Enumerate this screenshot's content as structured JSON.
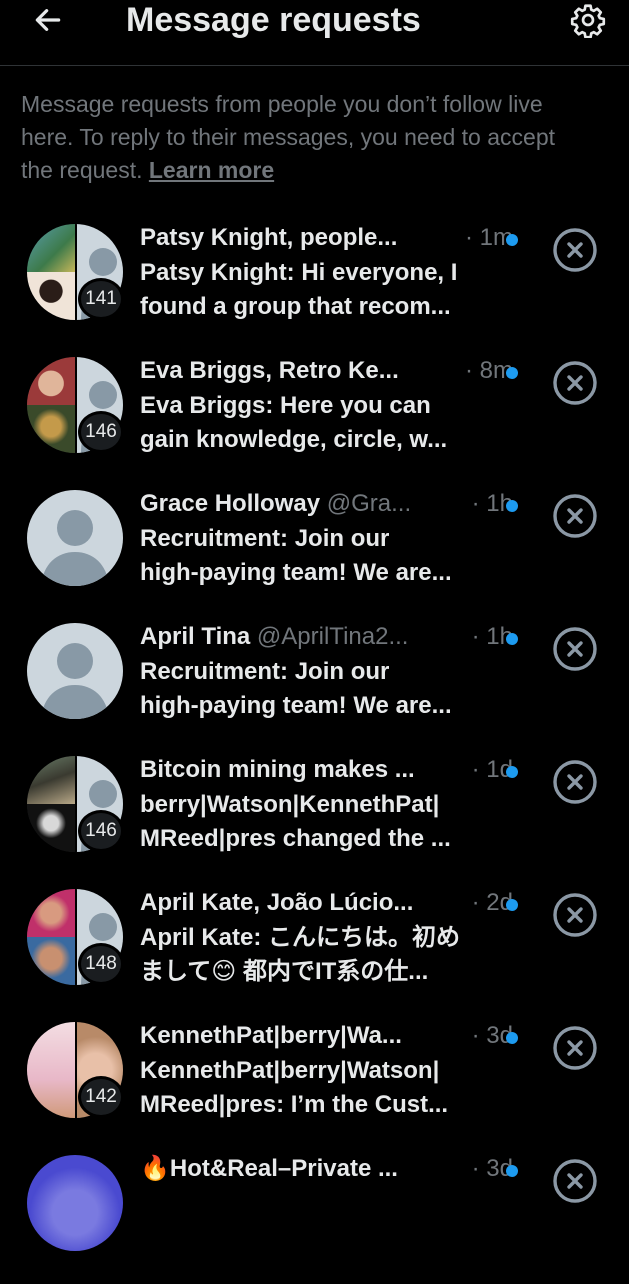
{
  "header": {
    "title": "Message requests"
  },
  "info": {
    "lines": [
      "Message requests from people you don’t follow live",
      "here. To reply to their messages, you need to accept",
      "the request."
    ],
    "learn_more": "Learn more"
  },
  "requests": [
    {
      "name": "Patsy Knight, people...",
      "handle": "",
      "time": "· 1m",
      "count": "141",
      "msg1": "Patsy Knight: Hi everyone, I",
      "msg2": "found a group that recom..."
    },
    {
      "name": "Eva Briggs, Retro Ke...",
      "handle": "",
      "time": "· 8m",
      "count": "146",
      "msg1": "Eva Briggs: Here you can",
      "msg2": "gain knowledge, circle, w..."
    },
    {
      "name": "Grace Holloway",
      "handle": "@Gra...",
      "time": "· 1h",
      "count": "",
      "msg1": "Recruitment: Join our",
      "msg2": "high-paying team! We are..."
    },
    {
      "name": "April Tina",
      "handle": "@AprilTina2...",
      "time": "· 1h",
      "count": "",
      "msg1": "Recruitment: Join our",
      "msg2": "high-paying team! We are..."
    },
    {
      "name": "Bitcoin mining makes ...",
      "handle": "",
      "time": "· 1d",
      "count": "146",
      "msg1": "berry|Watson|KennethPat|",
      "msg2": "MReed|pres changed the ..."
    },
    {
      "name": "April Kate, João Lúcio...",
      "handle": "",
      "time": "· 2d",
      "count": "148",
      "msg1": "April Kate: こんにちは。初め",
      "msg2": "まして😊 都内でIT系の仕..."
    },
    {
      "name": "KennethPat|berry|Wa...",
      "handle": "",
      "time": "· 3d",
      "count": "142",
      "msg1": "KennethPat|berry|Watson|",
      "msg2": "MReed|pres: I’m the Cust..."
    },
    {
      "name": "🔥Hot&Real–Private ...",
      "handle": "",
      "time": "· 3d",
      "count": "",
      "msg1": "",
      "msg2": ""
    }
  ],
  "colors": {
    "background": "#000000",
    "accent": "#1d9bf0",
    "muted": "#71767b",
    "text": "#e7e9ea"
  },
  "icons": {
    "back": "arrow-left-icon",
    "settings": "gear-icon",
    "dismiss": "close-circle-icon",
    "unread": "unread-dot"
  }
}
